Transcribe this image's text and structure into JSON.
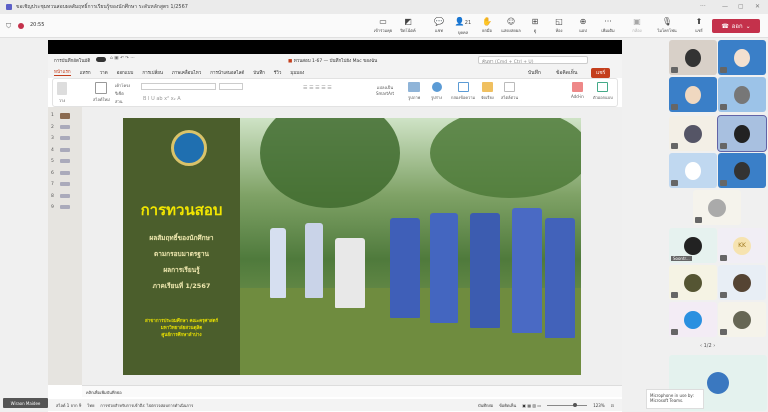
{
  "window": {
    "title": "ขอเชิญประชุมทวนสอบผลสัมฤทธิ์การเรียนรู้ของนักศึกษา ระดับหลักสูตร 1/2567",
    "min": "—",
    "max": "▢",
    "close": "✕",
    "more": "···"
  },
  "meeting": {
    "timer": "20:55",
    "buttons": [
      {
        "label": "เข้าร่วมคุย",
        "icon": "chat-join"
      },
      {
        "label": "ปิดโน้ตค์",
        "icon": "whiteboard"
      },
      {
        "label": "แชท",
        "icon": "chat"
      },
      {
        "label": "บุคคล",
        "icon": "people",
        "badge": "21"
      },
      {
        "label": "ยกมือ",
        "icon": "raise-hand"
      },
      {
        "label": "แสดงสดผล",
        "icon": "react"
      },
      {
        "label": "ดู",
        "icon": "view"
      },
      {
        "label": "ห้อง",
        "icon": "rooms"
      },
      {
        "label": "แอป",
        "icon": "apps"
      },
      {
        "label": "เพิ่มเติม",
        "icon": "more"
      },
      {
        "label": "กล้อง",
        "icon": "camera-off"
      },
      {
        "label": "ไมโครโฟน",
        "icon": "mic-off"
      },
      {
        "label": "แชร์",
        "icon": "share"
      }
    ],
    "leave": "ออก"
  },
  "ppt": {
    "autosave": "การบันทึกอัตโนมัติ",
    "doc_title": "ทวนสอบ 1-67 — บันทึกไปยัง Mac ของฉัน",
    "search_placeholder": "ค้นหา (Cmd + Ctrl + U)",
    "tabs": [
      "หน้าแรก",
      "แทรก",
      "วาด",
      "ออกแบบ",
      "การเปลี่ยน",
      "ภาพเคลื่อนไหว",
      "การนำเสนอสไลด์",
      "บันทึก",
      "รีวิว",
      "มุมมอง"
    ],
    "record": "บันทึก",
    "comments": "ข้อคิดเห็น",
    "share": "แชร์",
    "ribbon": {
      "paste": "วาง",
      "new_slide": "สไลด์ใหม่",
      "layout": "เค้าโครง",
      "reset": "รีเซ็ต",
      "section": "ส่วน",
      "convert": "แปลงเป็น SmartArt",
      "picture": "รูปภาพ",
      "shapes": "รูปร่าง",
      "textbox": "กล่องข้อความ",
      "arrange": "จัดเรียง",
      "quick_styles": "สไตล์ด่วน",
      "addins": "Add-in",
      "designer": "ตัวออกแบบ"
    },
    "thumbs": [
      "1",
      "2",
      "3",
      "4",
      "5",
      "6",
      "7",
      "8",
      "9"
    ],
    "notes_placeholder": "คลิกเพื่อเพิ่มบันทึกย่อ",
    "status": {
      "slide": "สไลด์ 1 จาก 9",
      "lang": "ไทย",
      "accessibility": "การช่วยสำหรับการเข้าถึง: ไปตรวจสอบการดำเนินการ",
      "notes": "บันทึกย่อ",
      "comments": "ข้อคิดเห็น",
      "zoom": "123%"
    },
    "zoom_percent": 123
  },
  "slide": {
    "title": "การทวนสอบ",
    "subtitle": [
      "ผลสัมฤทธิ์ของนักศึกษา",
      "ตามกรอบมาตรฐาน",
      "ผลการเรียนรู้",
      "ภาคเรียนที่ 1/2567"
    ],
    "footer": [
      "สาขาการประถมศึกษา คณะครุศาสตร์",
      "มหาวิทยาลัยสวนดุสิต",
      "ศูนย์การศึกษาลำปาง"
    ],
    "bg": "#4b5e2c",
    "title_color": "#f2e600"
  },
  "presenter_label": "Wiraon Maidee",
  "participants": {
    "named": "Soontr...",
    "initials": "KK",
    "page": "1/2",
    "prev": "‹",
    "next": "›"
  },
  "tooltip": "Microphone in use by: Microsoft Teams."
}
